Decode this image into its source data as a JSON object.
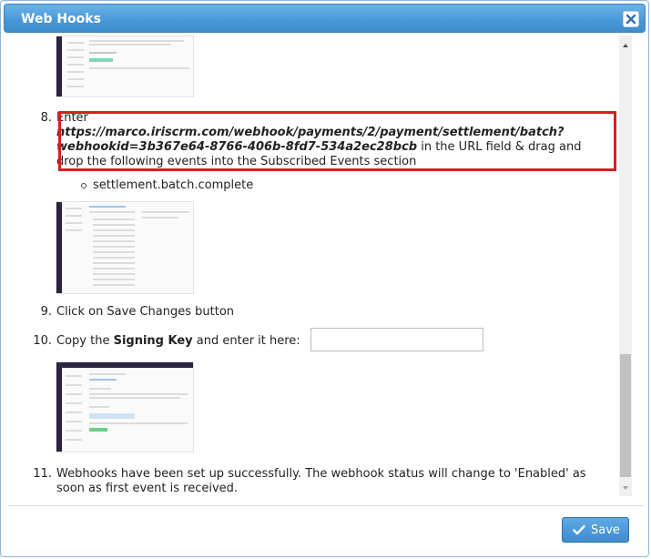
{
  "dialog": {
    "title": "Web Hooks",
    "close_icon": "close-icon",
    "accent": "#4797d6"
  },
  "steps": {
    "s8_num": "8.",
    "s8_enter": "Enter",
    "s8_url_line1": "https://marco.iriscrm.com/webhook/payments/2/payment/settlement/batch?",
    "s8_url_line2": "webhookid=3b367e64-8766-406b-8fd7-534a2ec28bcb",
    "s8_rest1": " in the URL field & drag and",
    "s8_rest2": "drop the following events into the Subscribed Events section",
    "s8_event": "settlement.batch.complete",
    "s9_num": "9.",
    "s9_text": "Click on Save Changes button",
    "s10_num": "10.",
    "s10_pre": "Copy the ",
    "s10_bold": "Signing Key",
    "s10_post": " and enter it here:",
    "s10_input_value": "",
    "s11_num": "11.",
    "s11_line1": "Webhooks have been set up successfully. The webhook status will change to 'Enabled' as",
    "s11_line2": "soon as first event is received."
  },
  "footer": {
    "save_label": "Save",
    "save_icon": "check-icon"
  }
}
